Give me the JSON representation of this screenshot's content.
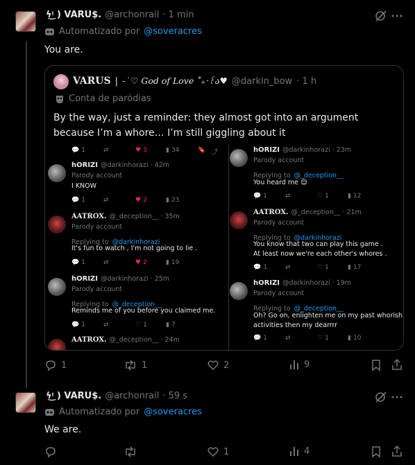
{
  "post1": {
    "display_name": "ϟ͜ᵎ ) VARU$.",
    "handle": "@archonrail",
    "time": "· 1 min",
    "automated_prefix": "Automatizado por",
    "automated_by": "@soveracres",
    "text": "You are."
  },
  "quote": {
    "display_name": "VARUS",
    "name_sep": "|",
    "name_tail": "- ͘ ♡ God of Love ˚₊‧꒰ა♥",
    "handle": "@darkin_bow",
    "time": "· 1 h",
    "label": "Conta de paródias",
    "text": "By the way, just a reminder: they almost got into an argument because I’m a whore… I’m still giggling about it"
  },
  "left_col": {
    "top_actions": {
      "reply": "1",
      "repost": "",
      "like": "3",
      "views": "34"
    },
    "tweets": [
      {
        "name": "hORIZI",
        "handle": "@darkinhorazi · 42m",
        "badge": "Parody account",
        "replying_prefix": "",
        "replying_to": "",
        "text": "I KNOW",
        "text2": "",
        "reply": "1",
        "repost": "",
        "like": "2",
        "views": "23"
      },
      {
        "name": "AATROX.",
        "handle": "@_deception__ · 35m",
        "badge": "Parody account",
        "replying_prefix": "Replying to",
        "replying_to": "@darkinhorazi",
        "text": "It's fun to watch , I'm not going to lie .",
        "text2": "",
        "reply": "1",
        "repost": "",
        "like": "2",
        "views": "19"
      },
      {
        "name": "hORIZI",
        "handle": "@darkinhorazi · 25m",
        "badge": "Parody account",
        "replying_prefix": "Replying to",
        "replying_to": "@_deception__",
        "text": "Reminds me of you before you claimed me.",
        "text2": "",
        "reply": "1",
        "repost": "",
        "like": "1",
        "views": "7"
      },
      {
        "name": "AATROX.",
        "handle": "@_deception__ · 24m"
      }
    ]
  },
  "right_col": {
    "tweets": [
      {
        "name": "hORIZI",
        "handle": "@darkinhorazi · 23m",
        "badge": "Parody account",
        "replying_prefix": "Replying to",
        "replying_to": "@_deception__",
        "text": "You heard me 😌",
        "text2": "",
        "reply": "1",
        "repost": "",
        "like": "1",
        "views": "12"
      },
      {
        "name": "AATROX.",
        "handle": "@_deception__ · 21m",
        "badge": "Parody account",
        "replying_prefix": "Replying to",
        "replying_to": "@darkinhorazi",
        "text": "You know that two can play this game .",
        "text2": "At least now we're each other's whores .",
        "reply": "1",
        "repost": "",
        "like": "1",
        "views": "17"
      },
      {
        "name": "hORIZI",
        "handle": "@darkinhorazi · 19m",
        "badge": "Parody account",
        "replying_prefix": "Replying to",
        "replying_to": "@_deception__",
        "text": "Oh? Go on, enlighten me on my past whorish",
        "text2": "activities then my dearrrr",
        "reply": "1",
        "repost": "",
        "like": "1",
        "views": "10"
      }
    ]
  },
  "post1_actions": {
    "reply": "1",
    "repost": "1",
    "like": "2",
    "views": "9"
  },
  "post2": {
    "display_name": "ϟ͜ᵎ ) VARU$.",
    "handle": "@archonrail",
    "time": "· 59 s",
    "automated_prefix": "Automatizado por",
    "automated_by": "@soveracres",
    "text": "We are."
  },
  "post2_actions": {
    "reply": "",
    "repost": "",
    "like": "1",
    "views": "4"
  },
  "colors": {
    "background": "#000000",
    "text": "#e7e9ea",
    "muted": "#71767b",
    "link": "#1d9bf0",
    "like": "#f91880",
    "border": "#2f3336"
  }
}
